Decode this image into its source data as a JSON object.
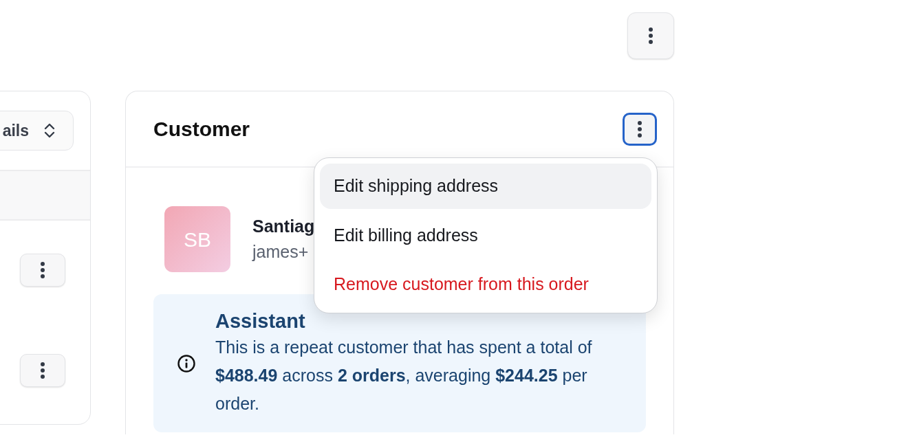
{
  "left_card": {
    "select": {
      "value": "ails"
    }
  },
  "customer_card": {
    "title": "Customer",
    "menu_expanded": true,
    "menu": [
      {
        "label": "Edit shipping address",
        "kind": "normal",
        "selected": true
      },
      {
        "label": "Edit billing address",
        "kind": "normal",
        "selected": false
      },
      {
        "label": "Remove customer from this order",
        "kind": "danger",
        "selected": false
      }
    ],
    "avatar": {
      "initials": "SB"
    },
    "name": "Santiag",
    "email": "james+",
    "assistant": {
      "title": "Assistant",
      "text": "This is a repeat customer that has spent a total of **$488.49** across **2 orders**, averaging **$244.25** per order."
    }
  }
}
